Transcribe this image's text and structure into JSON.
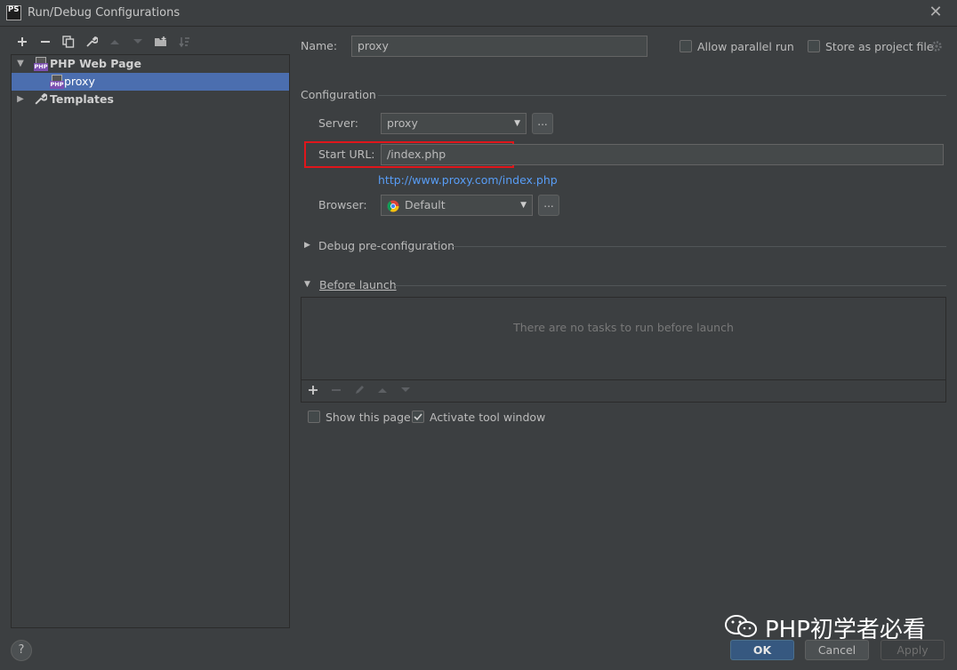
{
  "window": {
    "title": "Run/Debug Configurations",
    "app_badge": "PS",
    "close_glyph": "✕"
  },
  "toolbar": {
    "icons": [
      "add-icon",
      "remove-icon",
      "copy-icon",
      "wrench-icon",
      "move-up-icon",
      "move-down-icon",
      "new-folder-icon",
      "sort-icon"
    ]
  },
  "tree": {
    "group": {
      "label": "PHP Web Page",
      "icon_badge": "PHP"
    },
    "child": {
      "label": "proxy",
      "icon_badge": "PHP"
    },
    "templates": {
      "label": "Templates"
    }
  },
  "form": {
    "name_label": "Name:",
    "name_value": "proxy",
    "allow_parallel_label": "Allow parallel run",
    "allow_parallel_checked": false,
    "store_project_label": "Store as project file",
    "store_project_checked": false,
    "configuration_heading": "Configuration",
    "server_label": "Server:",
    "server_value": "proxy",
    "dots_label": "...",
    "start_url_label": "Start URL:",
    "start_url_value": "/index.php",
    "resolved_url": "http://www.proxy.com/index.php",
    "browser_label": "Browser:",
    "browser_value": "Default",
    "debug_preconfig_label": "Debug pre-configuration",
    "before_launch_label": "Before launch",
    "before_launch_empty": "There are no tasks to run before launch",
    "show_page_label": "Show this page",
    "show_page_checked": false,
    "activate_tool_label": "Activate tool window",
    "activate_tool_checked": true
  },
  "buttons": {
    "help": "?",
    "ok": "OK",
    "cancel": "Cancel",
    "apply": "Apply"
  },
  "watermark": {
    "text": "PHP初学者必看"
  },
  "colors": {
    "selection": "#4b6eaf",
    "highlight_border": "#e0161b",
    "link": "#589df6",
    "ok_button": "#365880"
  }
}
